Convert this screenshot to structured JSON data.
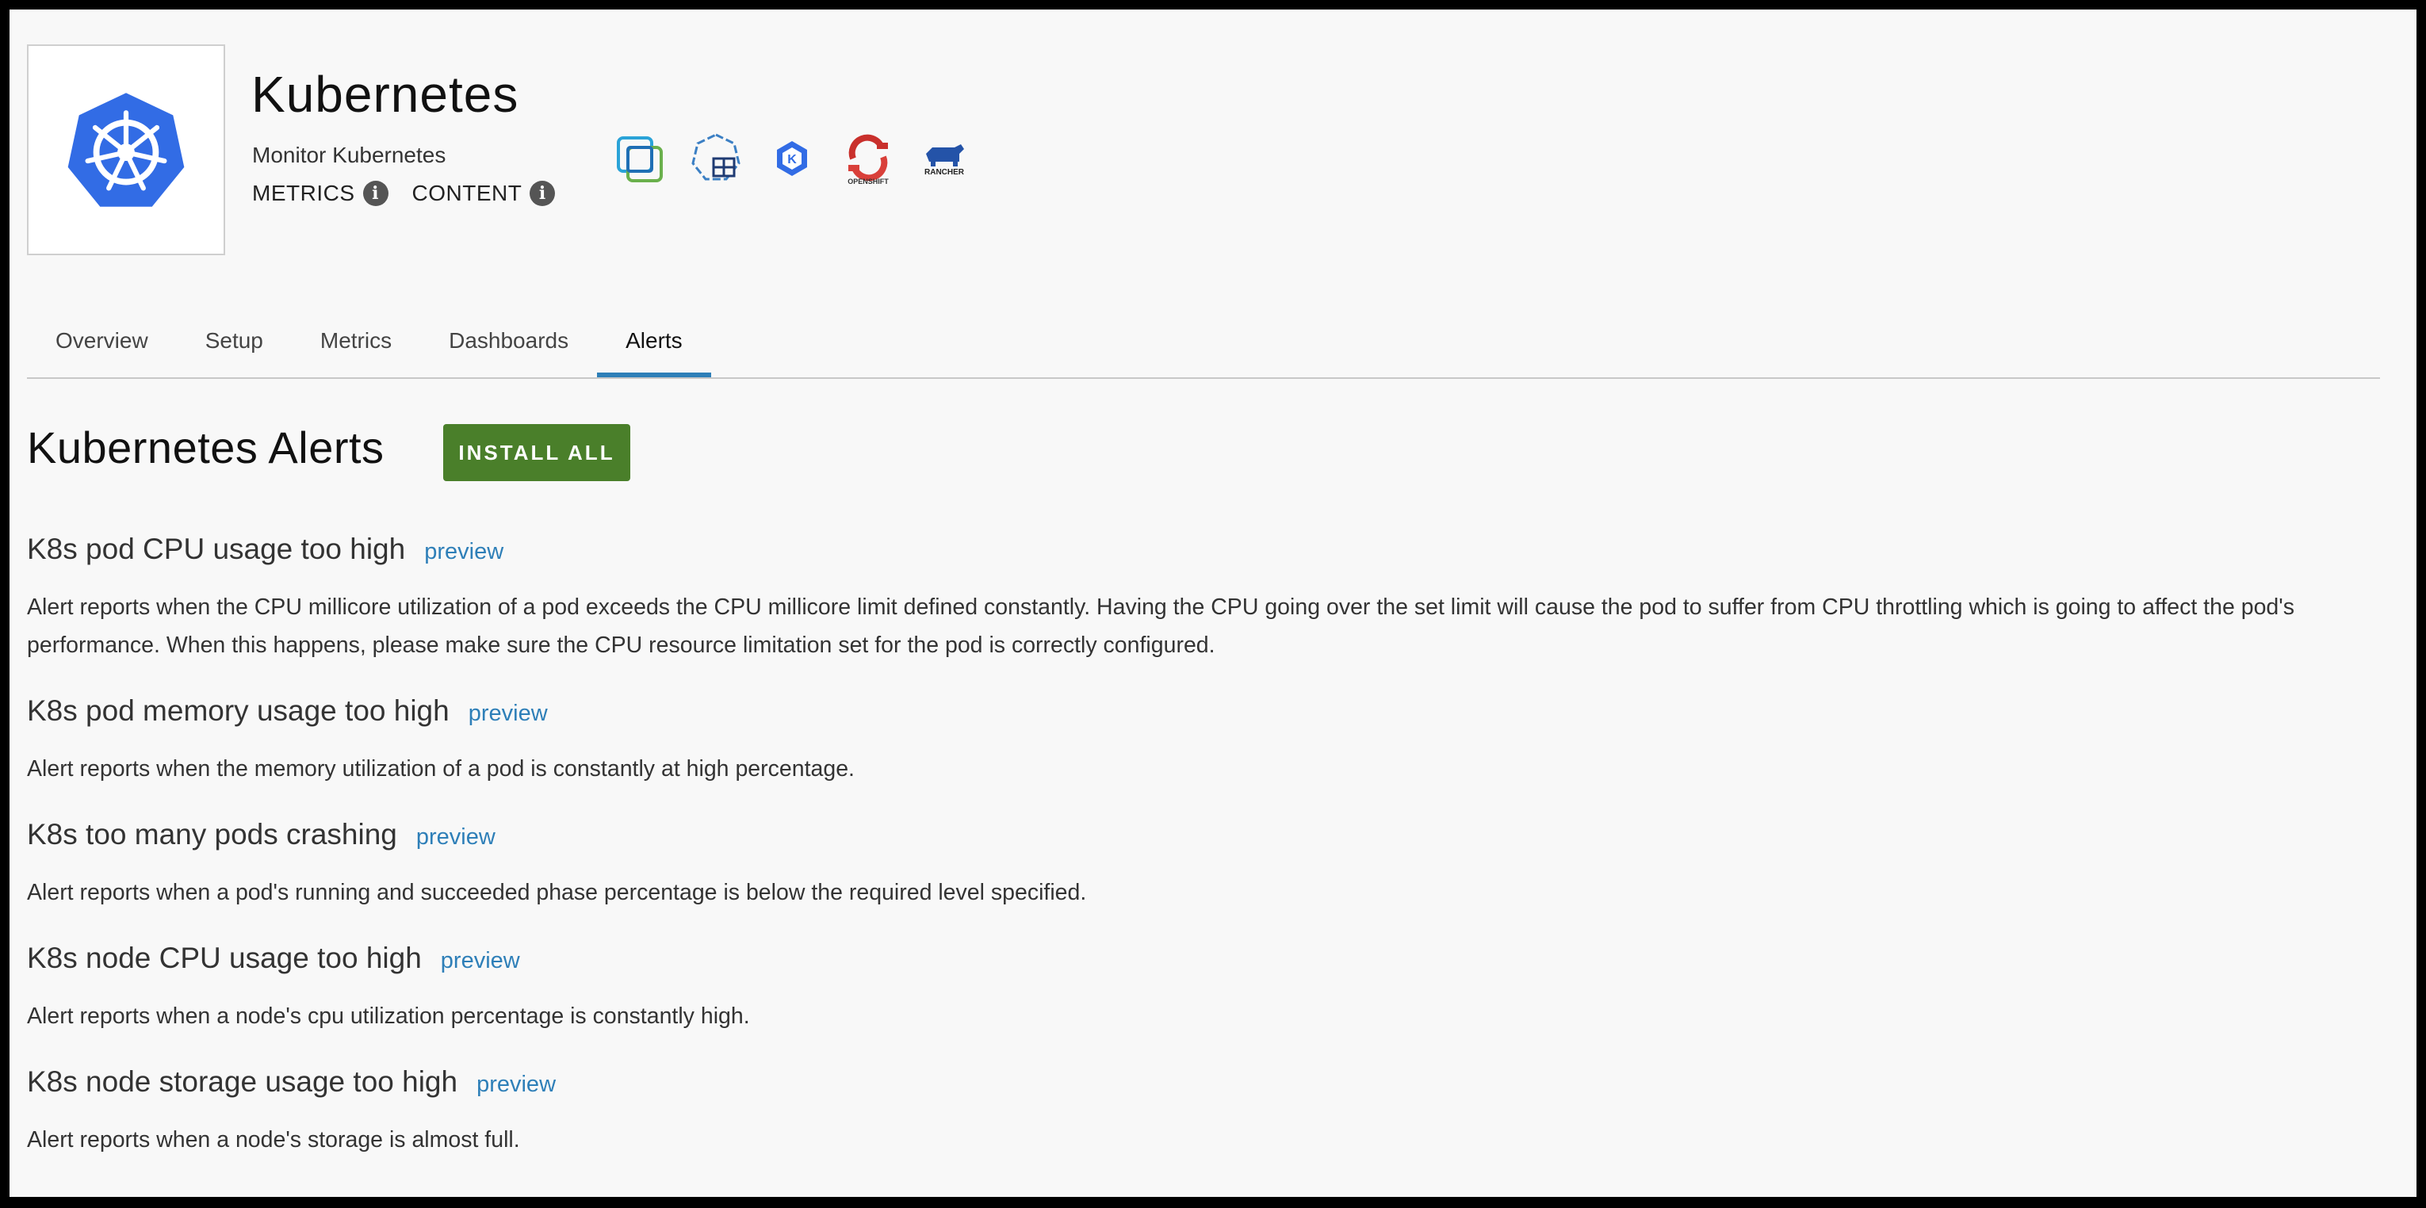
{
  "header": {
    "title": "Kubernetes",
    "subtitle": "Monitor Kubernetes",
    "tags": [
      {
        "label": "METRICS"
      },
      {
        "label": "CONTENT"
      }
    ],
    "logo_icon": "kubernetes-helm-wheel-icon",
    "platform_icons": [
      "vmware-tanzu-icon",
      "kubernetes-cluster-icon",
      "kubernetes-hex-icon",
      "openshift-icon",
      "rancher-icon"
    ],
    "openshift_label": "OPENSHIFT",
    "rancher_label": "RANCHER"
  },
  "tabs": [
    {
      "label": "Overview"
    },
    {
      "label": "Setup"
    },
    {
      "label": "Metrics"
    },
    {
      "label": "Dashboards"
    },
    {
      "label": "Alerts",
      "active": true
    }
  ],
  "alerts_section": {
    "title": "Kubernetes Alerts",
    "install_all_label": "INSTALL ALL",
    "preview_label": "preview",
    "items": [
      {
        "title": "K8s pod CPU usage too high",
        "description": "Alert reports when the CPU millicore utilization of a pod exceeds the CPU millicore limit defined constantly. Having the CPU going over the set limit will cause the pod to suffer from CPU throttling which is going to affect the pod's performance. When this happens, please make sure the CPU resource limitation set for the pod is correctly configured."
      },
      {
        "title": "K8s pod memory usage too high",
        "description": "Alert reports when the memory utilization of a pod is constantly at high percentage."
      },
      {
        "title": "K8s too many pods crashing",
        "description": "Alert reports when a pod's running and succeeded phase percentage is below the required level specified."
      },
      {
        "title": "K8s node CPU usage too high",
        "description": "Alert reports when a node's cpu utilization percentage is constantly high."
      },
      {
        "title": "K8s node storage usage too high",
        "description": "Alert reports when a node's storage is almost full."
      }
    ]
  },
  "colors": {
    "accent_blue": "#2e7fb8",
    "install_green": "#4a7f2a",
    "kubernetes_blue": "#326ce5"
  }
}
